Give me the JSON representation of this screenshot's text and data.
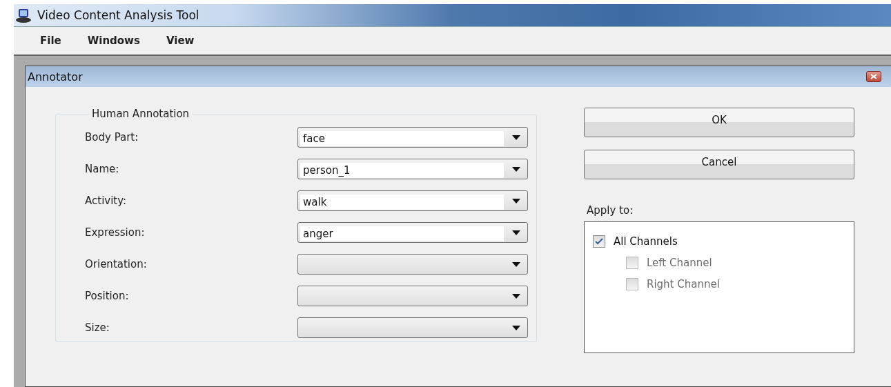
{
  "window": {
    "title": "Video Content Analysis Tool"
  },
  "menu": [
    "File",
    "Windows",
    "View"
  ],
  "dialog": {
    "title": "Annotator",
    "group": {
      "title": "Human Annotation",
      "fields": [
        {
          "label": "Body Part:",
          "value": "face"
        },
        {
          "label": "Name:",
          "value": "person_1"
        },
        {
          "label": "Activity:",
          "value": "walk"
        },
        {
          "label": "Expression:",
          "value": "anger"
        },
        {
          "label": "Orientation:"
        },
        {
          "label": "Position:"
        },
        {
          "label": "Size:"
        }
      ]
    },
    "buttons": [
      "OK",
      "Cancel"
    ],
    "apply_to": {
      "label": "Apply to:",
      "items": [
        {
          "label": "All Channels",
          "checked": true,
          "disabled": false,
          "children": [
            {
              "label": "Left Channel",
              "checked": false,
              "disabled": true
            },
            {
              "label": "Right Channel",
              "checked": false,
              "disabled": true
            }
          ]
        }
      ]
    }
  }
}
